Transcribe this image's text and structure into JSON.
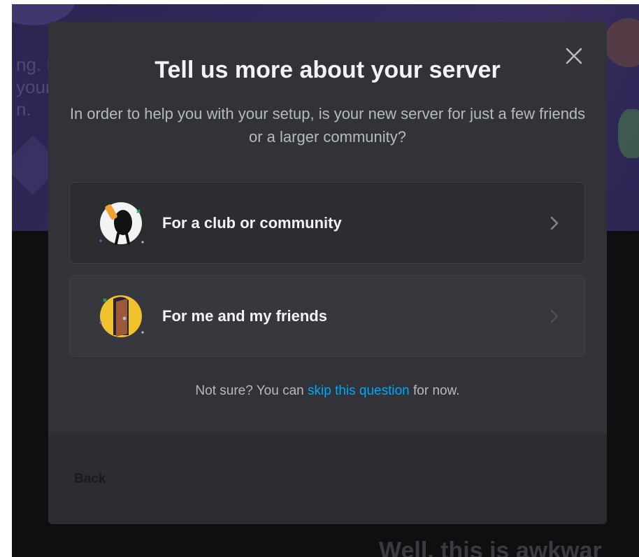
{
  "background": {
    "left_text_lines": [
      "ng. F",
      "your",
      "n."
    ],
    "bottom_text": "Well, this is awkwar"
  },
  "modal": {
    "title": "Tell us more about your server",
    "description": "In order to help you with your setup, is your new server for just a few friends or a larger community?",
    "close_icon": "close-icon",
    "options": [
      {
        "label": "For a club or community",
        "icon": "club-community-icon",
        "chevron": "chevron-right-icon"
      },
      {
        "label": "For me and my friends",
        "icon": "friends-door-icon",
        "chevron": "chevron-right-icon"
      }
    ],
    "footnote": {
      "prefix": "Not sure? You can ",
      "link": "skip this question",
      "suffix": " for now."
    },
    "footer": {
      "back_label": "Back"
    }
  },
  "colors": {
    "modal_bg": "#313338",
    "footer_bg": "#2b2d31",
    "link": "#00a8fc",
    "title": "#f2f3f5",
    "muted": "#b5bac1"
  }
}
